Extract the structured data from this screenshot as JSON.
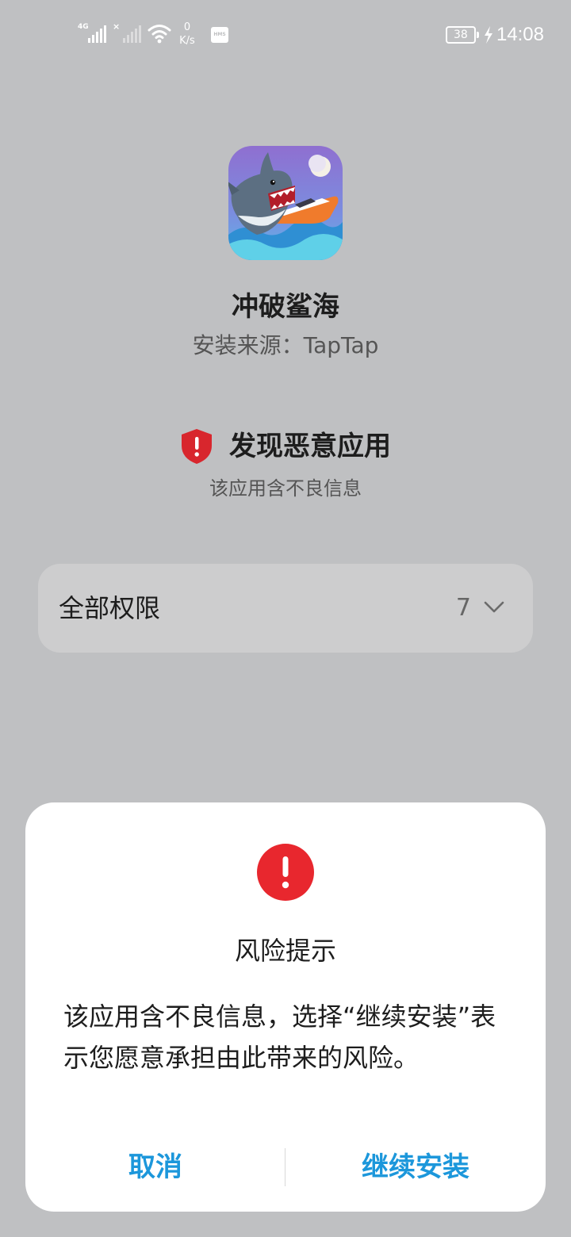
{
  "status_bar": {
    "network_type": "4G",
    "net_speed_value": "0",
    "net_speed_unit": "K/s",
    "hms_badge": "HMS",
    "battery_level": "38",
    "time": "14:08"
  },
  "app": {
    "name": "冲破鲨海",
    "install_source": "安装来源：TapTap",
    "icon": "shark-game-app-icon"
  },
  "warning": {
    "title": "发现恶意应用",
    "subtitle": "该应用含不良信息",
    "icon": "shield-alert-icon",
    "color": "#d8262d"
  },
  "permissions": {
    "label": "全部权限",
    "count": "7",
    "icon": "chevron-down-icon"
  },
  "dialog": {
    "icon": "alert-circle-icon",
    "icon_color": "#e8272e",
    "title": "风险提示",
    "message": "该应用含不良信息，选择“继续安装”表示您愿意承担由此带来的风险。",
    "cancel_label": "取消",
    "continue_label": "继续安装",
    "button_color": "#1c97db"
  }
}
